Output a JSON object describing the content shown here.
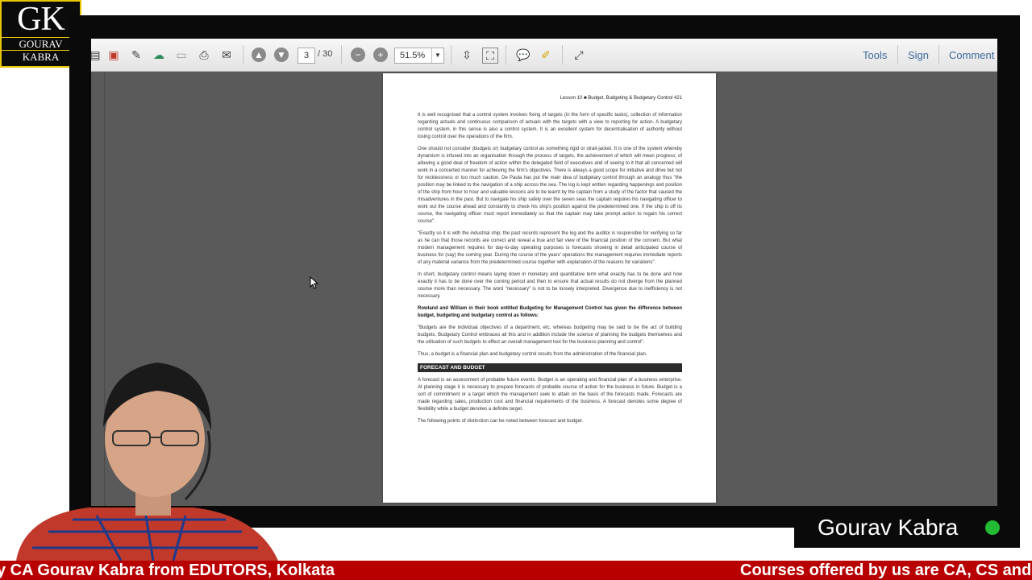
{
  "logo": {
    "mark": "GK",
    "line1": "GOURAV",
    "line2": "KABRA"
  },
  "toolbar": {
    "page_current": "3",
    "page_total": "/ 30",
    "zoom": "51.5%",
    "links": [
      "Tools",
      "Sign",
      "Comment"
    ]
  },
  "pdf": {
    "header": "Lesson 10 ■ Budget, Budgeting & Budgetary Control   421",
    "paragraphs": [
      "It is well recognised that a control system involves fixing of targets (in the form of specific tasks), collection of information regarding actuals and continuous comparison of actuals with the targets with a view to reporting for action. A budgetary control system, in this sense is also a control system. It is an excellent system for decentralisation of authority without losing control over the operations of the firm.",
      "One should not consider (budgets or) budgetary control as something rigid or strait-jacket. It is one of the system whereby dynamism is infused into an organisation through the process of targets, the achievement of which will mean progress; of allowing a good deal of freedom of action within the delegated field of executives and of seeing to it that all concerned will work in a concerted manner for achieving the firm's objectives. There is always a good scope for initiative and drive but not for recklessness or too much caution. De Paula has put the main idea of budgetary control through an analogy thus \"the position may be linked to the navigation of a ship across the sea. The log is kept written regarding happenings and position of the ship from hour to hour and valuable lessons are to be learnt by the captain from a study of the factor that caused the misadventures in the past. But to navigate his ship safely over the seven seas the captain requires his navigating officer to work out the course ahead and constantly to check his ship's position against the predetermined one. If the ship is off its course, the navigating officer must report immediately so that the captain may take prompt action to regain his correct course\".",
      "\"Exactly so it is with the industrial ship; the past records represent the log and the auditor is responsible for verifying so far as he can that those records are correct and reveal a true and fair view of the financial position of the concern. But what modern management requires for day-to-day operating purposes is forecasts showing in detail anticipated course of business for (say) the coming year. During the course of the years' operations the management requires immediate reports of any material variance from the predetermined course together with explanation of the reasons for variations\".",
      "In short, budgetary control means laying down in monetary and quantitative term what exactly has to be done and how exactly it has to be done over the coming period and then to ensure that actual results do not diverge from the planned course more than necessary. The word \"necessary\" is not to be loosely interpreted. Divergence due to inefficiency is not necessary."
    ],
    "bold_paragraph": "Rowland and William in their book entitled Budgeting for Management Control has given the difference between budget, budgeting and budgetary control as follows:",
    "paragraphs2": [
      "\"Budgets are the individual objectives of a department, etc. whereas budgeting may be said to be the act of building budgets. Budgetary Control embraces all this and in addition include the science of planning the budgets themselves and the utilisation of such budgets to effect an overall management tool for the business planning and control\".",
      "Thus, a budget is a financial plan and budgetary control results from the administration of the financial plan."
    ],
    "section_title": "FORECAST AND BUDGET",
    "paragraphs3": [
      "A forecast is an assessment of probable future events. Budget is an operating and financial plan of a business enterprise. At planning stage it is necessary to prepare forecasts of probable course of action for the business in future. Budget is a sort of commitment or a target which the management seek to attain on the basis of the forecasts made. Forecasts are made regarding sales, production cost and financial requirements of the business. A forecast denotes some degree of flexibility while a budget denotes a definite target.",
      "The following points of distinction can be noted between forecast and budget."
    ]
  },
  "presenter": {
    "name": "Gourav Kabra",
    "status_color": "#22bb33"
  },
  "ticker": {
    "left_text": "y CA Gourav Kabra from EDUTORS, Kolkata",
    "right_text": "Courses offered by us are CA, CS and"
  }
}
